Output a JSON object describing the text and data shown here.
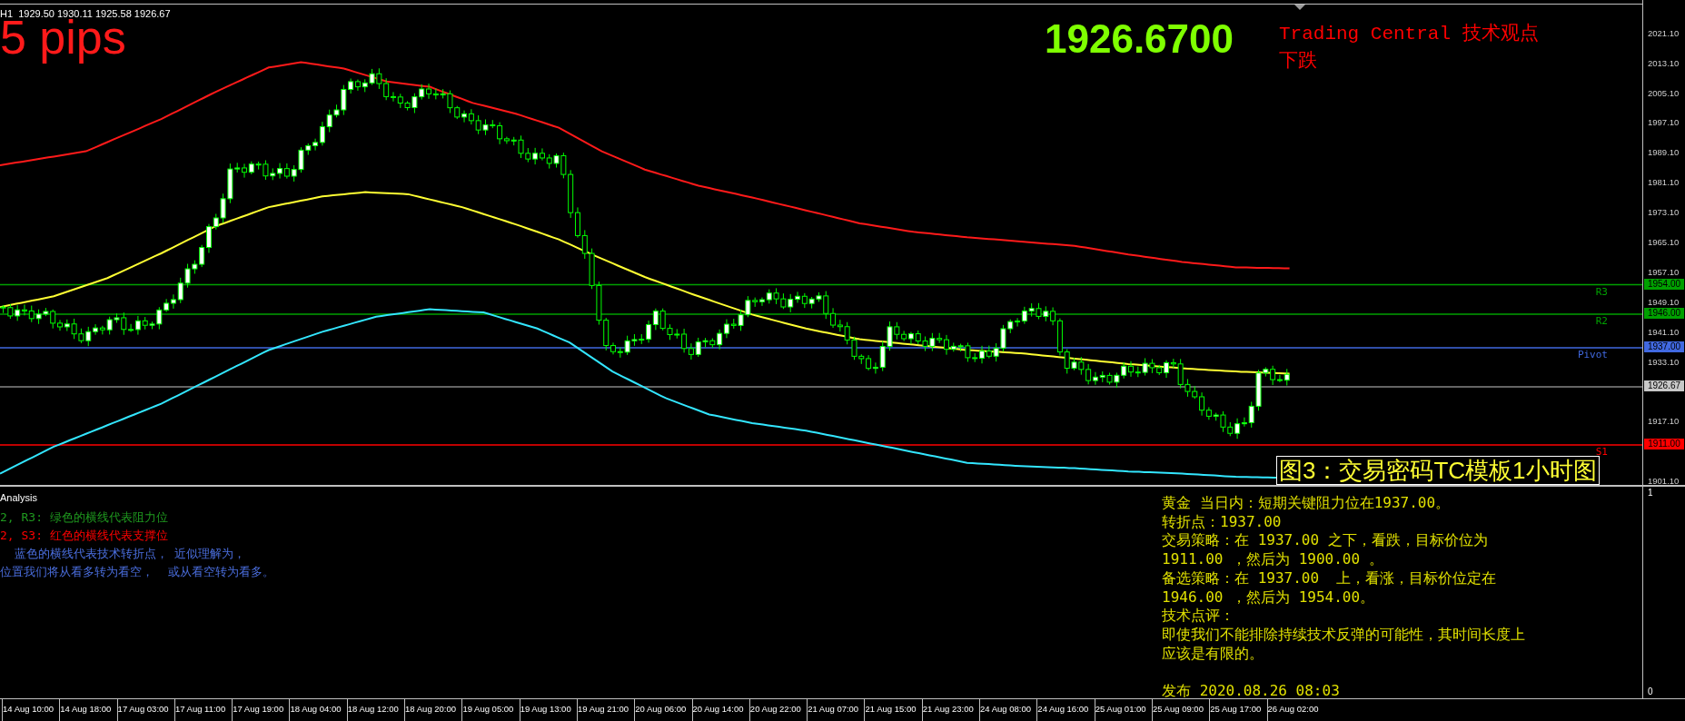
{
  "header": {
    "quote": "H1  1929.50 1930.11 1925.58 1926.67"
  },
  "pips_label": "5 pips",
  "price": "1926.6700",
  "view": {
    "title": "Trading Central 技术观点",
    "direction": "下跌"
  },
  "levels": [
    {
      "label": "R3",
      "tag": "1954.00",
      "color": "#00a000"
    },
    {
      "label": "R2",
      "tag": "1946.00",
      "color": "#00a000"
    },
    {
      "label": "Pivot",
      "tag": "1937.00",
      "color": "#4169e1"
    },
    {
      "tag": "1926.67",
      "color": "#c8c8c8"
    },
    {
      "label": "S1",
      "tag": "1911.00",
      "color": "#ff0000"
    }
  ],
  "caption": "图3：交易密码TC模板1小时图",
  "price_axis": [
    "2021.10",
    "2013.10",
    "2005.10",
    "1997.10",
    "1989.10",
    "1981.10",
    "1973.10",
    "1965.10",
    "1957.10",
    "1949.10",
    "1941.10",
    "1933.10",
    "1917.10",
    "1901.10"
  ],
  "analysis": {
    "title": "Analysis",
    "legend": [
      {
        "text": "2, R3: 绿色的横线代表阻力位",
        "color": "#1f9a1f"
      },
      {
        "text": "2, S3: 红色的横线代表支撑位",
        "color": "#ff0000"
      },
      {
        "text": "  蓝色的横线代表技术转折点， 近似理解为，",
        "color": "#4b6fe0"
      },
      {
        "text": "位置我们将从看多转为看空，  或从看空转为看多。",
        "color": "#4b6fe0"
      }
    ],
    "axis": [
      "1",
      "0"
    ],
    "report": [
      "黄金 当日内：短期关键阻力位在1937.00。",
      "转折点：1937.00",
      "交易策略：在 1937.00 之下，看跌，目标价位为",
      "1911.00 ，然后为 1900.00 。",
      "备选策略：在 1937.00  上，看涨，目标价位定在",
      "1946.00 ，然后为 1954.00。",
      "技术点评：",
      "即使我们不能排除持续技术反弹的可能性，其时间长度上",
      "应该是有限的。"
    ],
    "published": "发布 2020.08.26 08:03"
  },
  "time_axis": [
    "14 Aug 10:00",
    "14 Aug 18:00",
    "17 Aug 03:00",
    "17 Aug 11:00",
    "17 Aug 19:00",
    "18 Aug 04:00",
    "18 Aug 12:00",
    "18 Aug 20:00",
    "19 Aug 05:00",
    "19 Aug 13:00",
    "19 Aug 21:00",
    "20 Aug 06:00",
    "20 Aug 14:00",
    "20 Aug 22:00",
    "21 Aug 07:00",
    "21 Aug 15:00",
    "21 Aug 23:00",
    "24 Aug 08:00",
    "24 Aug 16:00",
    "25 Aug 01:00",
    "25 Aug 09:00",
    "25 Aug 17:00",
    "26 Aug 02:00"
  ]
}
